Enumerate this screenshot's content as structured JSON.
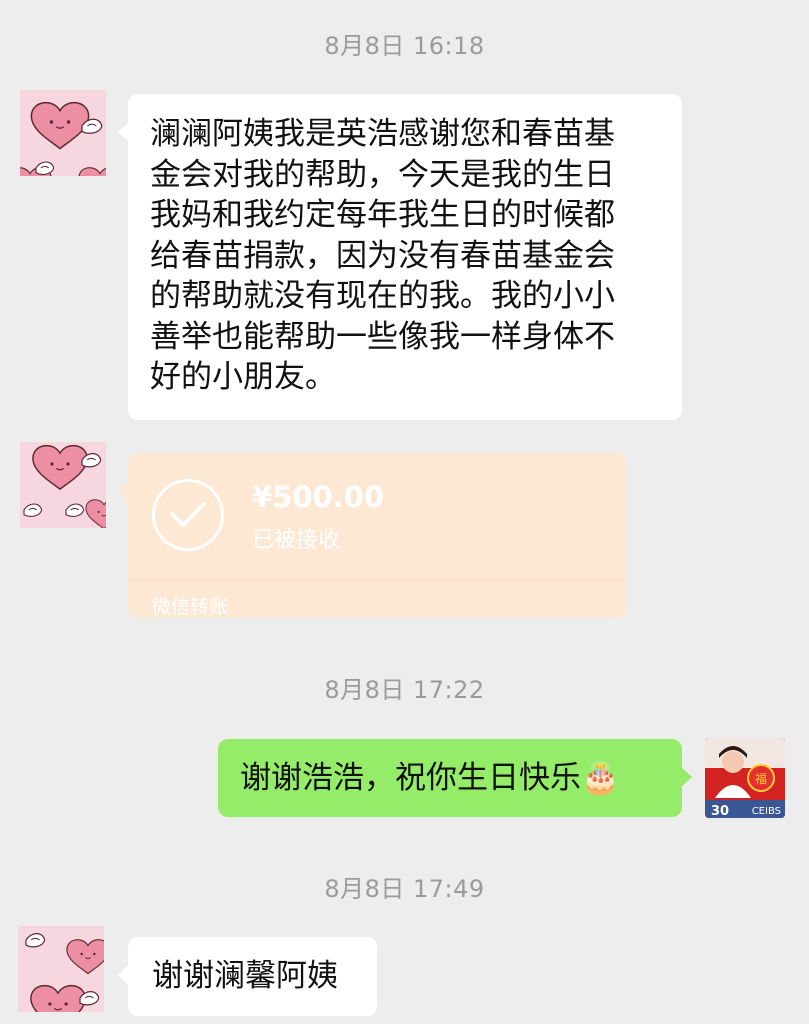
{
  "chat": {
    "timestamps": [
      "8月8日 16:18",
      "8月8日 17:22",
      "8月8日 17:49"
    ],
    "messages": [
      {
        "sender": "left",
        "lines": [
          "澜澜阿姨我是英浩感谢您和春苗基",
          "金会对我的帮助，今天是我的生日",
          "我妈和我约定每年我生日的时候都",
          "给春苗捐款，因为没有春苗基金会",
          "的帮助就没有现在的我。我的小小",
          "善举也能帮助一些像我一样身体不",
          "好的小朋友。"
        ]
      },
      {
        "sender": "left",
        "transfer": {
          "amount": "¥500.00",
          "status": "已被接收",
          "footer": "微信转账",
          "icon": "checkmark-circle-icon"
        }
      },
      {
        "sender": "right",
        "text": "谢谢浩浩，祝你生日快乐🎂"
      },
      {
        "sender": "left",
        "text": "谢谢澜馨阿姨"
      }
    ]
  },
  "avatars": {
    "left_icon": "heart-with-wings-avatar-icon",
    "right_badge": "CEIBS",
    "right_number": "30"
  },
  "colors": {
    "background": "#ededed",
    "bubble_left": "#ffffff",
    "bubble_right": "#95ec69",
    "transfer_bubble": "#fde8d4",
    "timestamp_text": "#9b9b9b"
  }
}
